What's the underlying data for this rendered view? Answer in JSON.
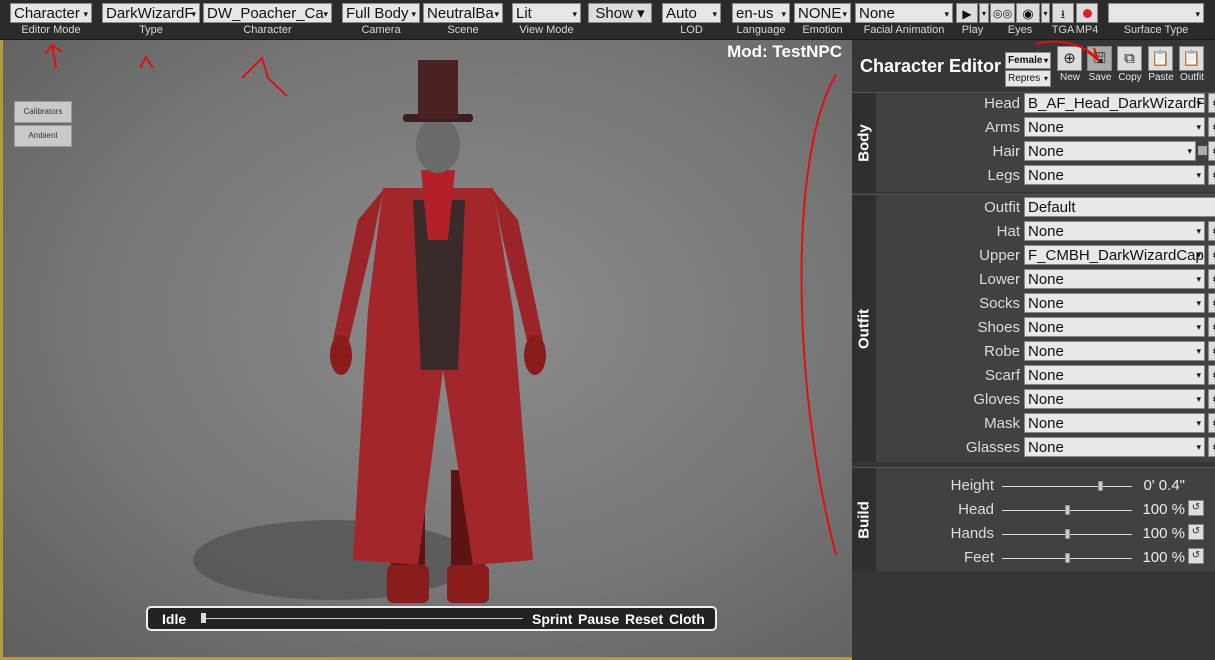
{
  "toolbar": {
    "editor_mode": {
      "value": "Character",
      "caption": "Editor Mode"
    },
    "type": {
      "value": "DarkWizardF",
      "caption": "Type"
    },
    "character": {
      "value": "DW_Poacher_Ca",
      "caption": "Character"
    },
    "camera": {
      "value": "Full Body",
      "caption": "Camera"
    },
    "scene": {
      "value": "NeutralBa",
      "caption": "Scene"
    },
    "view_mode": {
      "value": "Lit",
      "caption": "View Mode"
    },
    "show": {
      "value": "Show ▾"
    },
    "lod": {
      "value": "Auto",
      "caption": "LOD"
    },
    "language": {
      "value": "en-us",
      "caption": "Language"
    },
    "emotion": {
      "value": "NONE",
      "caption": "Emotion"
    },
    "facial_animation": {
      "value": "None",
      "caption": "Facial Animation"
    },
    "play": {
      "caption": "Play"
    },
    "eyes": {
      "caption": "Eyes"
    },
    "tga": {
      "caption": "TGA"
    },
    "mp4": {
      "caption": "MP4"
    },
    "surface_type": {
      "value": "",
      "caption": "Surface Type"
    }
  },
  "viewport": {
    "mod_label": "Mod: TestNPC",
    "calibrators": "Calibrators",
    "ambient": "Ambient",
    "anim_bar": {
      "idle": "Idle",
      "sprint": "Sprint",
      "pause": "Pause",
      "reset": "Reset",
      "cloth": "Cloth"
    }
  },
  "panel": {
    "title": "Character Editor",
    "gender": "Female",
    "repres": "Repres",
    "buttons": {
      "new": "New",
      "save": "Save",
      "copy": "Copy",
      "paste": "Paste",
      "outfit": "Outfit"
    },
    "body": {
      "section_label": "Body",
      "head": {
        "label": "Head",
        "value": "B_AF_Head_DarkWizardP"
      },
      "arms": {
        "label": "Arms",
        "value": "None"
      },
      "hair": {
        "label": "Hair",
        "value": "None"
      },
      "legs": {
        "label": "Legs",
        "value": "None"
      }
    },
    "outfit": {
      "section_label": "Outfit",
      "outfit": {
        "label": "Outfit",
        "value": "Default"
      },
      "hat": {
        "label": "Hat",
        "value": "None"
      },
      "upper": {
        "label": "Upper",
        "value": "F_CMBH_DarkWizardCap"
      },
      "lower": {
        "label": "Lower",
        "value": "None"
      },
      "socks": {
        "label": "Socks",
        "value": "None"
      },
      "shoes": {
        "label": "Shoes",
        "value": "None"
      },
      "robe": {
        "label": "Robe",
        "value": "None"
      },
      "scarf": {
        "label": "Scarf",
        "value": "None"
      },
      "gloves": {
        "label": "Gloves",
        "value": "None"
      },
      "mask": {
        "label": "Mask",
        "value": "None"
      },
      "glasses": {
        "label": "Glasses",
        "value": "None"
      }
    },
    "build": {
      "section_label": "Build",
      "height": {
        "label": "Height",
        "value": "0' 0.4\"",
        "level": 0.75
      },
      "head": {
        "label": "Head",
        "value": "100 %",
        "level": 0.5
      },
      "hands": {
        "label": "Hands",
        "value": "100 %",
        "level": 0.5
      },
      "feet": {
        "label": "Feet",
        "value": "100 %",
        "level": 0.5
      }
    }
  },
  "colors": {
    "accent_border": "#b59a3a",
    "record": "#e02020",
    "annotation": "#e01010"
  }
}
